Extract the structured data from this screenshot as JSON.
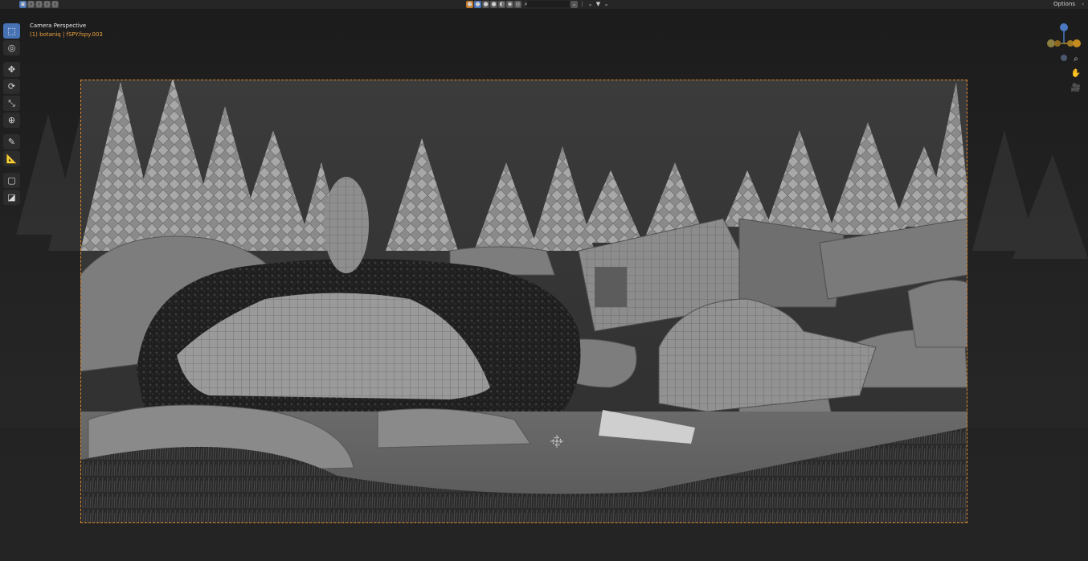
{
  "viewport": {
    "title": "Camera Perspective",
    "subtitle": "(1) botaniq | fSPY.fspy.003"
  },
  "header": {
    "options_label": "Options",
    "options_arrow": "‹"
  },
  "toolbar": {
    "tools": [
      "select-box",
      "cursor",
      "move",
      "rotate",
      "scale",
      "transform",
      "annotate",
      "measure",
      "add-cube",
      "extrude"
    ]
  },
  "colors": {
    "accent": "#4772b3",
    "camera_frame": "#e08a2c",
    "subtitle": "#e8a040",
    "gizmo_x": "#c48b1f",
    "gizmo_y": "#8c8040",
    "gizmo_z": "#4a78c2"
  }
}
